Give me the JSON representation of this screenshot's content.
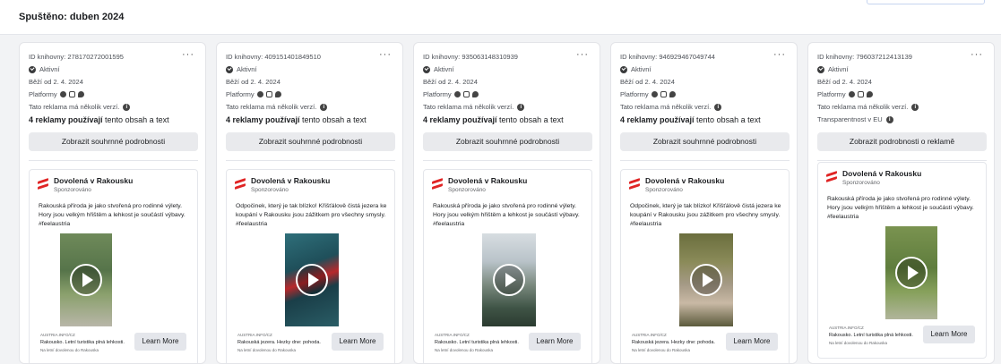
{
  "header": {
    "title": "Spuštěno: duben 2024"
  },
  "cards": [
    {
      "library_id": "ID knihovny: 278170272001595",
      "status": "Aktivní",
      "running_since": "Běží od 2. 4. 2024",
      "platforms_label": "Platformy",
      "multi_version": "Tato reklama má několik verzí.",
      "usage_bold": "4 reklamy používají",
      "usage_rest": " tento obsah a text",
      "summary_button": "Zobrazit souhrnné podrobnosti",
      "ad": {
        "advertiser": "Dovolená v Rakousku",
        "sponsored": "Sponzorováno",
        "body": "Rakouská příroda je jako stvořená pro rodinné výlety. Hory jsou velkým hřištěm a lehkost je součástí výbavy. #feelaustria",
        "source": "AUSTRIA.INFO/CZ",
        "headline": "Rakousko. Letní turistika plná lehkosti.",
        "subline": "Na letní dovolenou do Rakouska",
        "cta": "Learn More"
      }
    },
    {
      "library_id": "ID knihovny: 409151401849510",
      "status": "Aktivní",
      "running_since": "Běží od 2. 4. 2024",
      "platforms_label": "Platformy",
      "multi_version": "Tato reklama má několik verzí.",
      "usage_bold": "4 reklamy používají",
      "usage_rest": " tento obsah a text",
      "summary_button": "Zobrazit souhrnné podrobnosti",
      "ad": {
        "advertiser": "Dovolená v Rakousku",
        "sponsored": "Sponzorováno",
        "body": "Odpočinek, který je tak blízko! Křišťálově čistá jezera ke koupání v Rakousku jsou zážitkem pro všechny smysly. #feelaustria",
        "source": "AUSTRIA.INFO/CZ",
        "headline": "Rakouská jezera. Hezky dne: pohoda.",
        "subline": "Na letní dovolenou do Rakouska",
        "cta": "Learn More"
      }
    },
    {
      "library_id": "ID knihovny: 935063148310939",
      "status": "Aktivní",
      "running_since": "Běží od 2. 4. 2024",
      "platforms_label": "Platformy",
      "multi_version": "Tato reklama má několik verzí.",
      "usage_bold": "4 reklamy používají",
      "usage_rest": " tento obsah a text",
      "summary_button": "Zobrazit souhrnné podrobnosti",
      "ad": {
        "advertiser": "Dovolená v Rakousku",
        "sponsored": "Sponzorováno",
        "body": "Rakouská příroda je jako stvořená pro rodinné výlety. Hory jsou velkým hřištěm a lehkost je součástí výbavy. #feelaustria",
        "source": "AUSTRIA.INFO/CZ",
        "headline": "Rakousko. Letní turistika plná lehkosti.",
        "subline": "Na letní dovolenou do Rakouska",
        "cta": "Learn More"
      }
    },
    {
      "library_id": "ID knihovny: 946929467049744",
      "status": "Aktivní",
      "running_since": "Běží od 2. 4. 2024",
      "platforms_label": "Platformy",
      "multi_version": "Tato reklama má několik verzí.",
      "usage_bold": "4 reklamy používají",
      "usage_rest": " tento obsah a text",
      "summary_button": "Zobrazit souhrnné podrobnosti",
      "ad": {
        "advertiser": "Dovolená v Rakousku",
        "sponsored": "Sponzorováno",
        "body": "Odpočinek, který je tak blízko! Křišťálově čistá jezera ke koupání v Rakousku jsou zážitkem pro všechny smysly. #feelaustria",
        "source": "AUSTRIA.INFO/CZ",
        "headline": "Rakouská jezera. Hezky dne: pohoda.",
        "subline": "Na letní dovolenou do Rakouska",
        "cta": "Learn More"
      }
    },
    {
      "library_id": "ID knihovny: 796037212413139",
      "status": "Aktivní",
      "running_since": "Běží od 2. 4. 2024",
      "platforms_label": "Platformy",
      "multi_version": "Tato reklama má několik verzí.",
      "transparency": "Transparentnost v EU",
      "summary_button": "Zobrazit podrobnosti o reklamě",
      "ad": {
        "advertiser": "Dovolená v Rakousku",
        "sponsored": "Sponzorováno",
        "body": "Rakouská příroda je jako stvořená pro rodinné výlety. Hory jsou velkým hřištěm a lehkost je součástí výbavy. #feelaustria",
        "source": "AUSTRIA.INFO/CZ",
        "headline": "Rakousko. Letní turistika plná lehkosti.",
        "subline": "Na letní dovolenou do Rakouska",
        "cta": "Learn More"
      }
    }
  ],
  "icons": {
    "more": "more-options-icon",
    "status": "check-circle-icon",
    "facebook": "facebook-icon",
    "instagram": "instagram-icon",
    "messenger": "messenger-icon",
    "info": "info-icon",
    "play": "play-icon",
    "logo": "austria-flag-logo-icon"
  },
  "colors": {
    "brand_red": "#e02424",
    "button_bg": "#e9eaed",
    "text": "#1c1e21"
  }
}
